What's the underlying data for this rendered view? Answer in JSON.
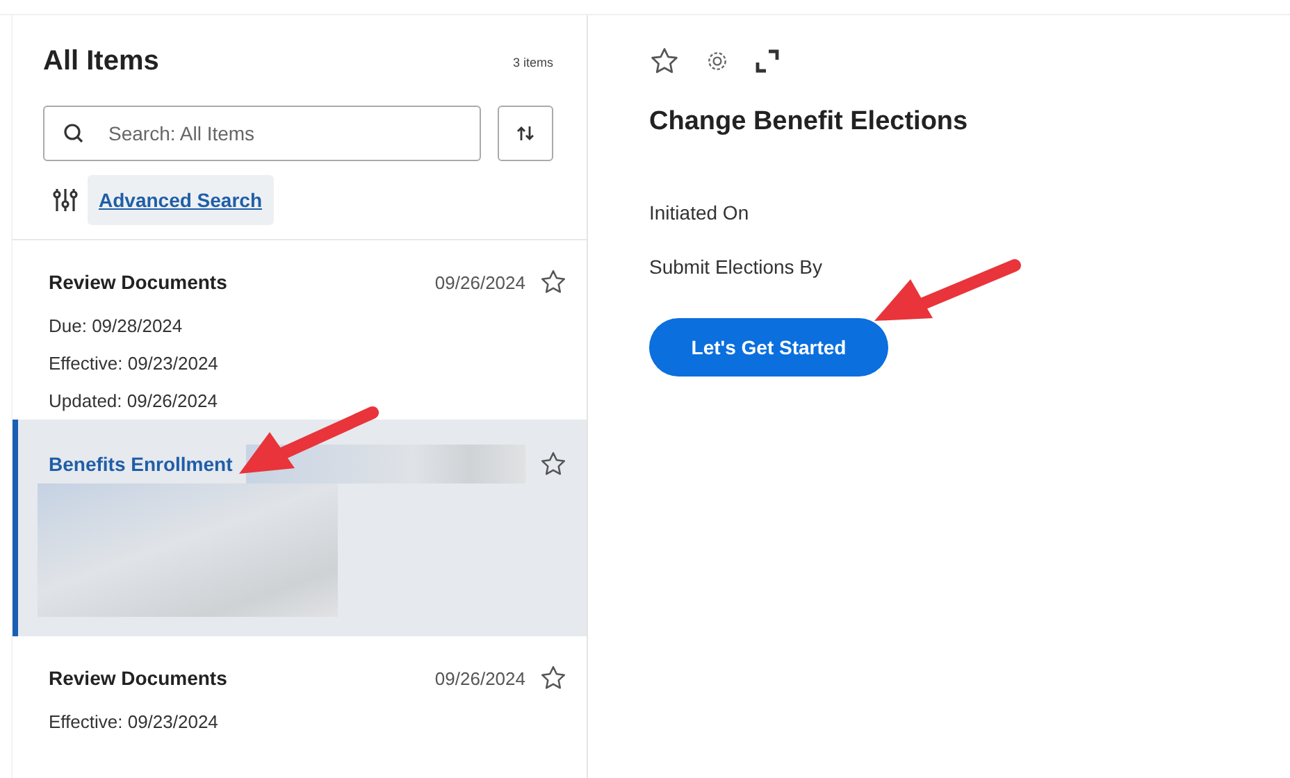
{
  "list_panel": {
    "title": "All Items",
    "count": "3 items",
    "search": {
      "placeholder": "Search: All Items"
    },
    "advanced_search": "Advanced Search"
  },
  "items": [
    {
      "title": "Review Documents",
      "date": "09/26/2024",
      "lines": [
        "Due: 09/28/2024",
        "Effective: 09/23/2024",
        "Updated: 09/26/2024"
      ],
      "selected": false,
      "starred": false,
      "redacted": false
    },
    {
      "title": "Benefits Enrollment",
      "selected": true,
      "starred": false,
      "redacted": true
    },
    {
      "title": "Review Documents",
      "date": "09/26/2024",
      "lines": [
        "Effective: 09/23/2024"
      ],
      "selected": false,
      "starred": false,
      "redacted": false
    }
  ],
  "detail": {
    "title": "Change Benefit Elections",
    "fields": [
      "Initiated On",
      "Submit Elections By"
    ],
    "button": "Let's Get Started"
  }
}
